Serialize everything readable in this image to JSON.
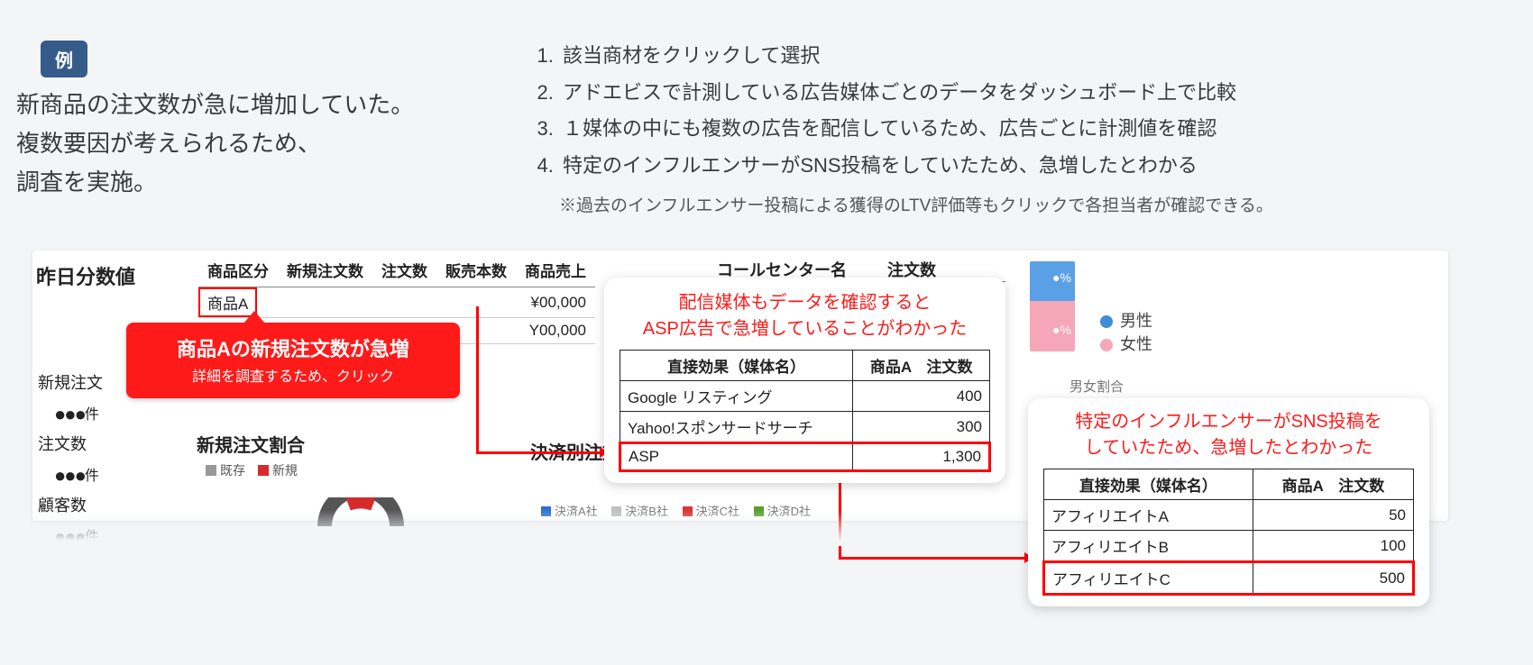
{
  "example_badge": "例",
  "intro": {
    "l1": "新商品の注文数が急に増加していた。",
    "l2": "複数要因が考えられるため、",
    "l3": "調査を実施。"
  },
  "steps": {
    "s1": "該当商材をクリックして選択",
    "s2": "アドエビスで計測している広告媒体ごとのデータをダッシュボード上で比較",
    "s3": "１媒体の中にも複数の広告を配信しているため、広告ごとに計測値を確認",
    "s4": "特定のインフルエンサーがSNS投稿をしていたため、急増したとわかる",
    "note": "※過去のインフルエンサー投稿による獲得のLTV評価等もクリックで各担当者が確認できる。"
  },
  "section_title": "昨日分数値",
  "prod_headers": {
    "h1": "商品区分",
    "h2": "新規注文数",
    "h3": "注文数",
    "h4": "販売本数",
    "h5": "商品売上"
  },
  "prod_row1": {
    "c1": "商品A",
    "c5": "¥00,000"
  },
  "prod_row2": {
    "c5": "Y00,000"
  },
  "callout1": {
    "t1": "商品Aの新規注文数が急増",
    "t2": "詳細を調査するため、クリック"
  },
  "stats": {
    "r1": {
      "label": "新規注文",
      "value": "●●●",
      "unit": "件"
    },
    "r2": {
      "label": "注文数",
      "value": "●●●",
      "unit": "件"
    },
    "r3": {
      "label": "顧客数",
      "value": "●●●",
      "unit": "件"
    }
  },
  "ratio_title": "新規注文割合",
  "ratio_legend": {
    "a": "既存",
    "b": "新規"
  },
  "payment_title": "決済別注文数",
  "pay_legend": {
    "a": "決済A社",
    "b": "決済B社",
    "c": "決済C社",
    "d": "決済D社"
  },
  "cc": {
    "h1": "コールセンター名",
    "h2": "注文数"
  },
  "float1": {
    "text1": "配信媒体もデータを確認すると",
    "text2": "ASP広告で急増していることがわかった",
    "head1": "直接効果（媒体名）",
    "head2": "商品A　注文数",
    "r1": {
      "n": "Google リスティング",
      "v": "400"
    },
    "r2": {
      "n": "Yahoo!スポンサードサーチ",
      "v": "300"
    },
    "r3": {
      "n": "ASP",
      "v": "1,300"
    }
  },
  "float2": {
    "text1": "特定のインフルエンサーがSNS投稿を",
    "text2": "していたため、急増したとわかった",
    "head1": "直接効果（媒体名）",
    "head2": "商品A　注文数",
    "r1": {
      "n": "アフィリエイトA",
      "v": "50"
    },
    "r2": {
      "n": "アフィリエイトB",
      "v": "100"
    },
    "r3": {
      "n": "アフィリエイトC",
      "v": "500"
    }
  },
  "gender": {
    "pct1": "●%",
    "pct2": "●%",
    "male": "男性",
    "female": "女性",
    "caption": "男女割合"
  },
  "chart_data": [
    {
      "type": "table",
      "title": "直接効果（媒体名）別 商品A 注文数",
      "categories": [
        "Google リスティング",
        "Yahoo!スポンサードサーチ",
        "ASP"
      ],
      "values": [
        400,
        300,
        1300
      ]
    },
    {
      "type": "table",
      "title": "アフィリエイト別 商品A 注文数",
      "categories": [
        "アフィリエイトA",
        "アフィリエイトB",
        "アフィリエイトC"
      ],
      "values": [
        50,
        100,
        500
      ]
    }
  ]
}
